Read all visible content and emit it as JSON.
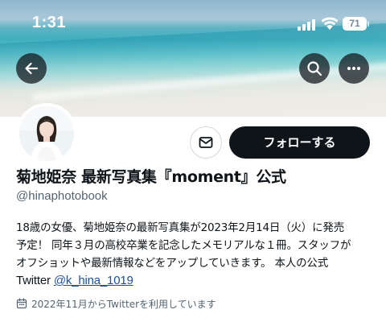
{
  "status_bar": {
    "time": "1:31",
    "battery": "71"
  },
  "header": {
    "back_icon": "arrow-left-icon",
    "search_icon": "search-icon",
    "more_icon": "more-horizontal-icon"
  },
  "profile": {
    "display_name": "菊地姫奈 最新写真集『moment』公式",
    "handle": "@hinaphotobook",
    "bio_lines": [
      "18歳の女優、菊地姫奈の最新写真集が2023年2月14日（火）に発売",
      "予定！ 同年３月の高校卒業を記念したメモリアルな１冊。スタッフが",
      "オフショットや最新情報などをアップしていきます。 本人の公式"
    ],
    "bio_last_prefix": "Twitter",
    "bio_mention": "@k_hina_1019",
    "joined": "2022年11月からTwitterを利用しています"
  },
  "actions": {
    "message_icon": "mail-icon",
    "follow_label": "フォローする"
  },
  "colors": {
    "follow_bg": "#0f1419",
    "mention": "#1d4f9e",
    "secondary_text": "#536471"
  }
}
